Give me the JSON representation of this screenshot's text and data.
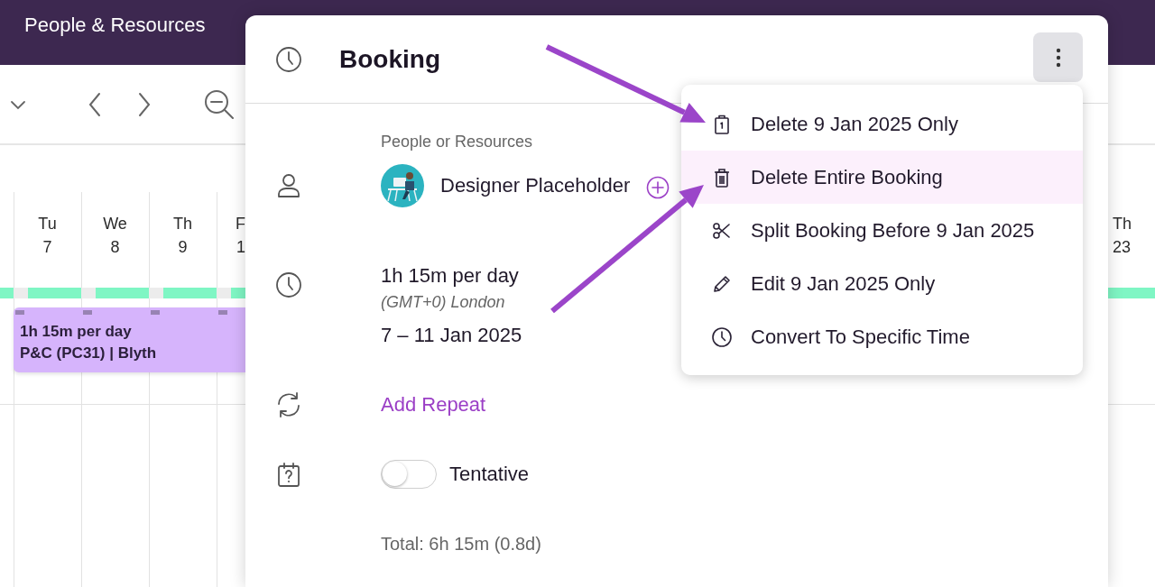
{
  "header": {
    "title": "People & Resources"
  },
  "calendar": {
    "days": [
      {
        "weekday": "Tu",
        "date": "7"
      },
      {
        "weekday": "We",
        "date": "8"
      },
      {
        "weekday": "Th",
        "date": "9"
      },
      {
        "weekday": "F",
        "date": "1"
      }
    ],
    "right_days": [
      {
        "weekday": "Th",
        "date": "23"
      }
    ],
    "booking": {
      "line_1": "1h 15m per day",
      "line_2": "P&C (PC31) | Blyth"
    }
  },
  "dialog": {
    "title": "Booking",
    "people_label": "People or Resources",
    "person": "Designer Placeholder",
    "duration": "1h 15m per day",
    "timezone": "(GMT+0) London",
    "date_range": "7 – 11 Jan 2025",
    "repeat_link": "Add Repeat",
    "tentative": {
      "label": "Tentative",
      "on": false
    },
    "total": "Total: 6h 15m (0.8d)"
  },
  "menu": {
    "items": [
      {
        "label": "Delete 9 Jan 2025 Only",
        "kind": "day",
        "selected": false
      },
      {
        "label": "Delete Entire Booking",
        "kind": "trash",
        "selected": true
      },
      {
        "label": "Split Booking Before 9 Jan 2025",
        "kind": "scissors",
        "selected": false
      },
      {
        "label": "Edit 9 Jan 2025 Only",
        "kind": "pencil",
        "selected": false
      },
      {
        "label": "Convert To Specific Time",
        "kind": "clock",
        "selected": false
      }
    ]
  }
}
